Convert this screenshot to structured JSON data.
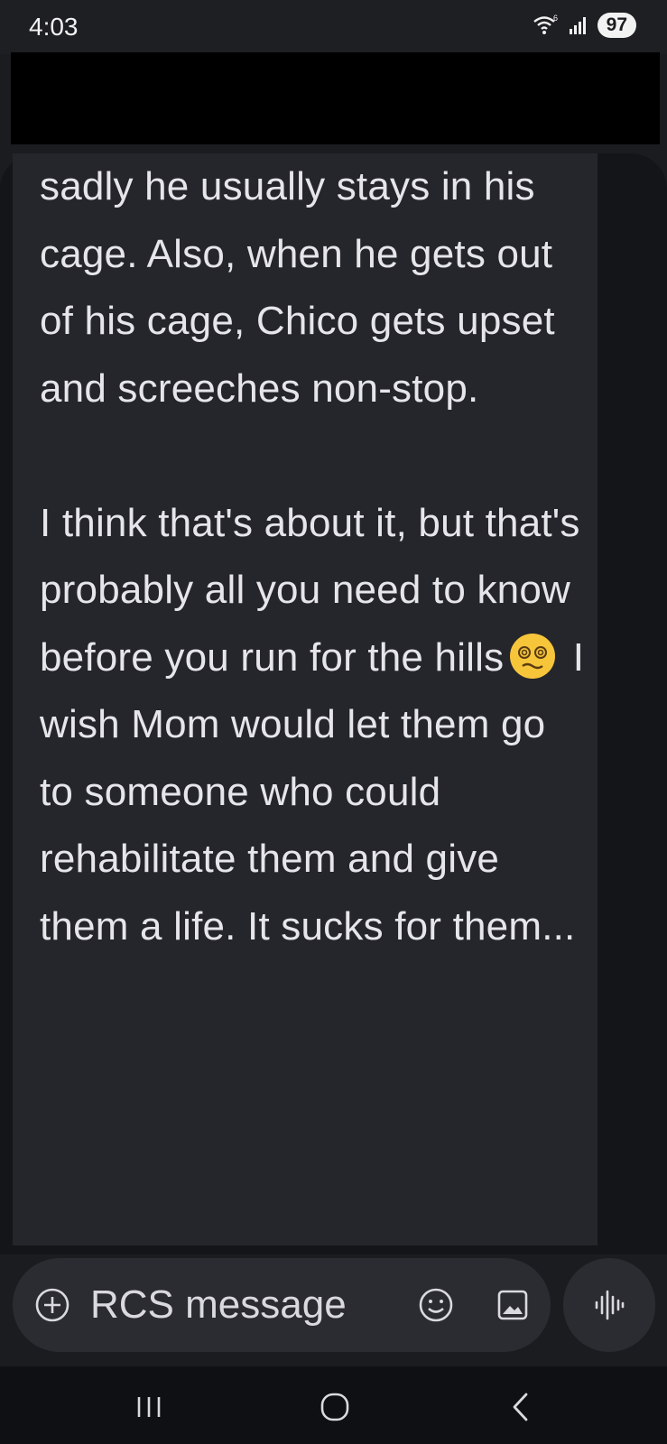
{
  "status_bar": {
    "time": "4:03",
    "battery": "97",
    "icons": [
      "wifi-6-icon",
      "signal-icon",
      "battery-icon"
    ]
  },
  "message": {
    "paragraphs": [
      "sadly he usually stays in his cage. Also, when he gets out of his cage, Chico gets upset and screeches non-stop.",
      "I think that's about it, but that's probably all you need to know before you run for the hills",
      "I wish Mom would let them go to someone who could rehabilitate them and give them a life. It sucks for them..."
    ],
    "emoji": "face-with-spiral-eyes"
  },
  "composer": {
    "placeholder": "RCS message",
    "icons": [
      "add-icon",
      "emoji-icon",
      "gallery-icon"
    ],
    "voice_icon": "voice-waveform-icon"
  },
  "nav": {
    "icons": [
      "recents-icon",
      "home-icon",
      "back-icon"
    ]
  },
  "colors": {
    "background": "#1b1c20",
    "bubble": "#25262b",
    "text": "#e6e6ea",
    "composer": "#2b2c31"
  }
}
